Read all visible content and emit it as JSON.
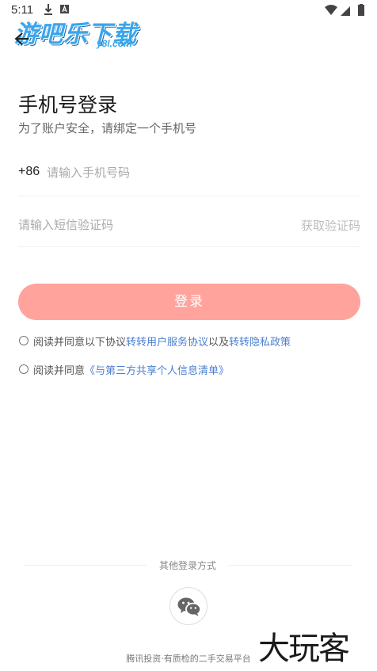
{
  "status_bar": {
    "time": "5:11"
  },
  "watermark": {
    "main": "游吧乐下载",
    "sub": "y8l.com"
  },
  "header": {
    "title": "手机号登录",
    "subtitle": "为了账户安全，请绑定一个手机号"
  },
  "phone": {
    "country_code": "+86",
    "placeholder": "请输入手机号码",
    "value": ""
  },
  "code": {
    "placeholder": "请输入短信验证码",
    "value": "",
    "get_code_label": "获取验证码"
  },
  "login_button": {
    "label": "登录"
  },
  "agreements": {
    "row1_prefix": "阅读并同意以下协议",
    "row1_link1": "转转用户服务协议",
    "row1_middle": "以及",
    "row1_link2": "转转隐私政策",
    "row2_prefix": "阅读并同意",
    "row2_link": "《与第三方共享个人信息清单》"
  },
  "other_login": {
    "label": "其他登录方式",
    "icon": "wechat-icon"
  },
  "footer": {
    "text": "腾讯投资·有质检的二手交易平台"
  },
  "corner_brand": {
    "text": "大玩客"
  },
  "colors": {
    "login_button_bg": "#ffa39c",
    "link": "#4a7fd0",
    "watermark": "#39a6ec"
  }
}
